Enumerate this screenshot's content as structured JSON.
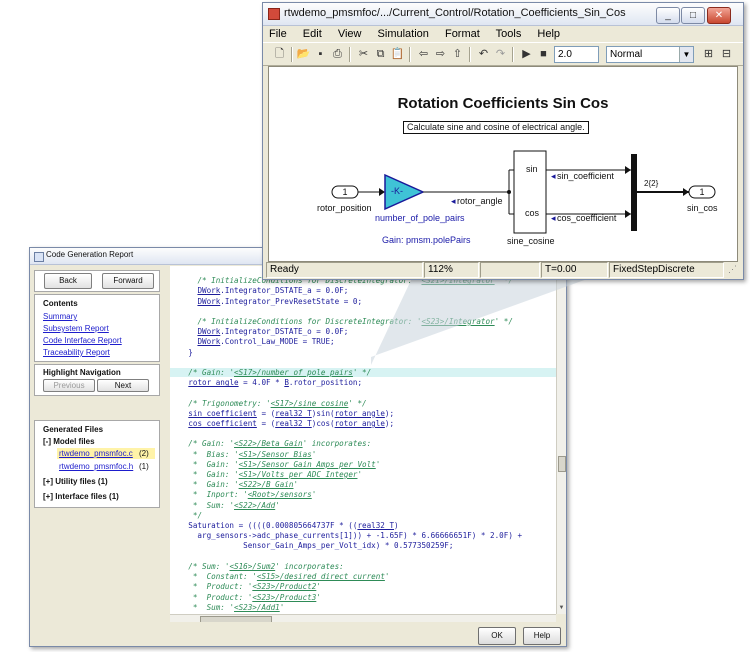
{
  "simulink": {
    "title": "rtwdemo_pmsmfoc/.../Current_Control/Rotation_Coefficients_Sin_Cos",
    "menu": [
      "File",
      "Edit",
      "View",
      "Simulation",
      "Format",
      "Tools",
      "Help"
    ],
    "toolbar": {
      "stop_time": "2.0",
      "mode": "Normal"
    },
    "diagram": {
      "heading": "Rotation Coefficients Sin Cos",
      "annotation": "Calculate sine and cosine of electrical angle.",
      "inport_label": "1",
      "inport_name": "rotor_position",
      "gain_symbol": "-K-",
      "gain_name": "number_of_pole_pairs",
      "gain_param": "Gain: pmsm.polePairs",
      "signal_rotor_angle": "rotor_angle",
      "trig_port_sin": "sin",
      "trig_port_cos": "cos",
      "trig_name": "sine_cosine",
      "signal_sin": "sin_coefficient",
      "signal_cos": "cos_coefficient",
      "mux_width": "2{2}",
      "outport_label": "1",
      "outport_name": "sin_cos"
    },
    "status": {
      "state": "Ready",
      "zoom": "112%",
      "time": "T=0.00",
      "solver": "FixedStepDiscrete"
    }
  },
  "report": {
    "title": "Code Generation Report",
    "back_label": "Back",
    "forward_label": "Forward",
    "contents_heading": "Contents",
    "contents_links": [
      "Summary",
      "Subsystem Report",
      "Code Interface Report",
      "Traceability Report"
    ],
    "highlight_heading": "Highlight Navigation",
    "previous_label": "Previous",
    "next_label": "Next",
    "generated_heading": "Generated Files",
    "model_files_label": "[-] Model files",
    "files": [
      {
        "name": "rtwdemo_pmsmfoc.c",
        "count": "(2)"
      },
      {
        "name": "rtwdemo_pmsmfoc.h",
        "count": "(1)"
      }
    ],
    "utility_files_label": "[+] Utility files (1)",
    "interface_files_label": "[+] Interface files (1)",
    "ok_label": "OK",
    "help_label": "Help"
  }
}
